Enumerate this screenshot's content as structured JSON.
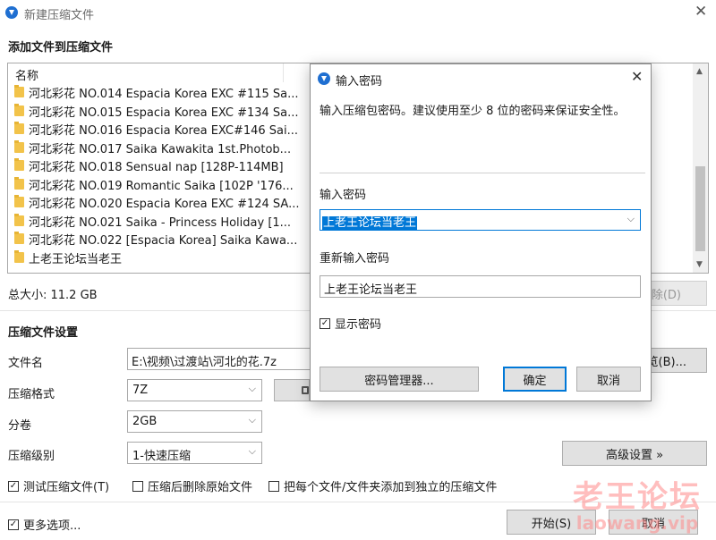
{
  "window": {
    "title": "新建压缩文件",
    "close_glyph": "✕"
  },
  "add_files": {
    "heading": "添加文件到压缩文件",
    "column_name": "名称",
    "items": [
      "河北彩花 NO.014 Espacia Korea EXC #115 Sa...",
      "河北彩花 NO.015 Espacia Korea EXC #134 Sa...",
      "河北彩花 NO.016 Espacia Korea EXC#146 Sai...",
      "河北彩花 NO.017 Saika Kawakita 1st.Photob...",
      "河北彩花 NO.018 Sensual nap [128P-114MB]",
      "河北彩花 NO.019 Romantic Saika [102P '176...",
      "河北彩花 NO.020 Espacia Korea EXC #124 SA...",
      "河北彩花 NO.021 Saika - Princess Holiday [1...",
      "河北彩花 NO.022 [Espacia Korea] Saika Kawa...",
      "上老王论坛当老王"
    ],
    "total_size": "总大小: 11.2 GB",
    "delete_button": "除(D)"
  },
  "settings": {
    "heading": "压缩文件设置",
    "filename_label": "文件名",
    "filename_value": "E:\\视频\\过渡站\\河北的花.7z",
    "browse_button": "览(B)...",
    "format_label": "压缩格式",
    "format_value": "7Z",
    "split_label": "分卷",
    "split_value": "2GB",
    "level_label": "压缩级别",
    "level_value": "1-快速压缩",
    "advanced_button": "高级设置 »",
    "test_check": "测试压缩文件(T)",
    "delete_after_check": "压缩后删除原始文件",
    "separate_check": "把每个文件/文件夹添加到独立的压缩文件",
    "more_options": "更多选项...",
    "start_button": "开始(S)",
    "cancel_button": "取消"
  },
  "password_dialog": {
    "title": "输入密码",
    "description": "输入压缩包密码。建议使用至少 8 位的密码来保证安全性。",
    "password_label": "输入密码",
    "password_value": "上老王论坛当老王",
    "reenter_label": "重新输入密码",
    "reenter_value": "上老王论坛当老王",
    "show_password": "显示密码",
    "manager_button": "密码管理器...",
    "ok_button": "确定",
    "cancel_button": "取消"
  },
  "watermark": {
    "text_cn": "老王论坛",
    "text_en": "laowang.vip"
  },
  "colors": {
    "accent": "#0078d7",
    "folder": "#f2c34a",
    "watermark": "#ff8a8a"
  }
}
